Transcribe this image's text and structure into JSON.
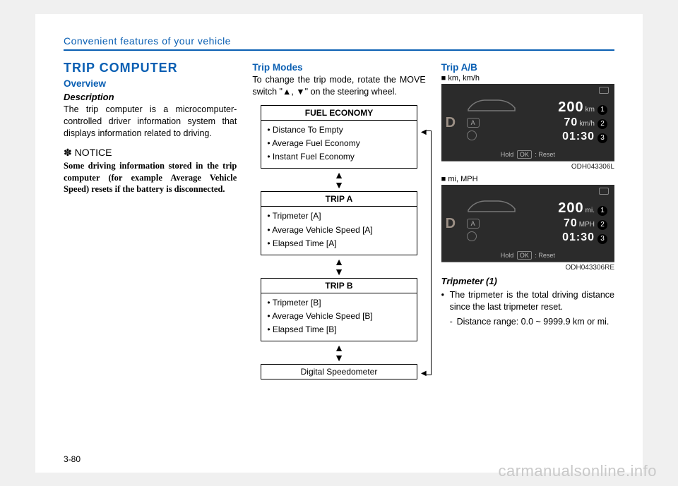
{
  "header": "Convenient features of your vehicle",
  "section_title": "TRIP COMPUTER",
  "overview": {
    "title": "Overview",
    "subtitle": "Description",
    "body": "The trip computer is a microcomputer-controlled driver information system that displays information related to driving.",
    "notice_label": "✽ NOTICE",
    "notice_body": "Some driving information stored in the trip computer (for example Average Vehicle Speed) resets if the battery is disconnected."
  },
  "trip_modes": {
    "title": "Trip Modes",
    "body": "To change the trip mode, rotate the MOVE switch \"▲, ▼\" on the steering wheel.",
    "boxes": [
      {
        "head": "FUEL ECONOMY",
        "items": [
          "Distance To Empty",
          "Average Fuel Economy",
          "Instant Fuel Economy"
        ]
      },
      {
        "head": "TRIP A",
        "items": [
          "Tripmeter [A]",
          "Average Vehicle Speed [A]",
          "Elapsed Time [A]"
        ]
      },
      {
        "head": "TRIP B",
        "items": [
          "Tripmeter [B]",
          "Average Vehicle Speed [B]",
          "Elapsed Time [B]"
        ]
      }
    ],
    "last_box": "Digital Speedometer"
  },
  "trip_ab": {
    "title": "Trip A/B",
    "fig1": {
      "label": "■ km, km/h",
      "gear": "D",
      "rows": [
        {
          "val": "200",
          "unit": "km",
          "tag": "1"
        },
        {
          "val": "70",
          "unit": "km/h",
          "tag": "2"
        },
        {
          "val": "01:30",
          "unit": "",
          "tag": "3"
        }
      ],
      "a_badge": "A",
      "reset": {
        "hold": "Hold",
        "ok": "OK",
        "label": ": Reset"
      },
      "code": "ODH043306L"
    },
    "fig2": {
      "label": "■ mi, MPH",
      "gear": "D",
      "rows": [
        {
          "val": "200",
          "unit": "mi.",
          "tag": "1"
        },
        {
          "val": "70",
          "unit": "MPH",
          "tag": "2"
        },
        {
          "val": "01:30",
          "unit": "",
          "tag": "3"
        }
      ],
      "a_badge": "A",
      "reset": {
        "hold": "Hold",
        "ok": "OK",
        "label": ": Reset"
      },
      "code": "ODH043306RE"
    },
    "tripmeter": {
      "title": "Tripmeter (1)",
      "bullet": "The tripmeter is the total driving distance since the last tripmeter reset.",
      "sub": "Distance range: 0.0 ~ 9999.9 km or mi."
    }
  },
  "page_number": "3-80",
  "watermark": "carmanualsonline.info"
}
